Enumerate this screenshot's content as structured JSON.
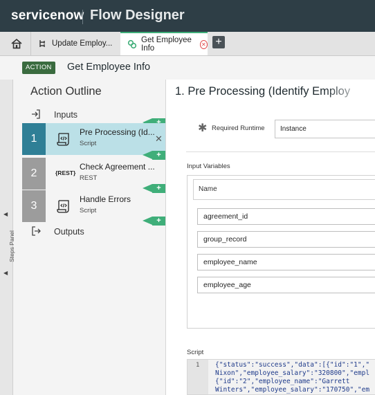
{
  "header": {
    "brand": "servicenow",
    "product": "Flow Designer"
  },
  "tabs": {
    "home_icon": "home-icon",
    "items": [
      {
        "label": "Update Employ...",
        "icon": "flow-icon",
        "active": false
      },
      {
        "label": "Get Employee Info",
        "icon": "action-icon",
        "active": true
      }
    ],
    "add_label": "+"
  },
  "action_header": {
    "badge": "ACTION",
    "title": "Get Employee Info"
  },
  "steps_panel": {
    "label": "Steps Panel"
  },
  "outline": {
    "title": "Action Outline",
    "inputs_label": "Inputs",
    "outputs_label": "Outputs",
    "steps": [
      {
        "number": "1",
        "name": "Pre Processing (Id...",
        "type": "Script",
        "icon": "script-icon",
        "selected": true
      },
      {
        "number": "2",
        "name": "Check Agreement ...",
        "type": "REST",
        "icon": "rest-icon",
        "icon_text": "{REST}",
        "selected": false
      },
      {
        "number": "3",
        "name": "Handle Errors",
        "type": "Script",
        "icon": "script-icon",
        "selected": false
      }
    ],
    "add_step_label": "+"
  },
  "editor": {
    "title": "1.  Pre Processing (Identify Employ",
    "required_runtime_label": "Required Runtime",
    "required_runtime_value": "Instance",
    "input_variables_label": "Input Variables",
    "name_header": "Name",
    "variables": [
      "agreement_id",
      "group_record",
      "employee_name",
      "employee_age"
    ],
    "script_label": "Script",
    "code_line_number": "1",
    "code_lines": [
      "{\"status\":\"success\",\"data\":[{\"id\":\"1\",\"",
      "Nixon\",\"employee_salary\":\"320800\",\"empl",
      "{\"id\":\"2\",\"employee_name\":\"Garrett",
      "Winters\",\"employee_salary\":\"170750\",\"em"
    ]
  },
  "colors": {
    "topbar": "#2e3e46",
    "accent_green": "#3fae79",
    "selected_step": "#bbe0e7",
    "selected_num": "#2f7f96"
  }
}
